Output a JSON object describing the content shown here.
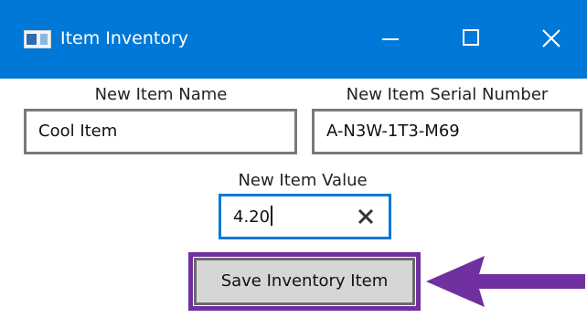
{
  "window": {
    "title": "Item Inventory",
    "icons": {
      "app": "app-window-icon",
      "minimize": "minimize-icon",
      "maximize": "maximize-icon",
      "close": "close-icon"
    }
  },
  "form": {
    "name": {
      "label": "New Item Name",
      "value": "Cool Item"
    },
    "serial": {
      "label": "New Item Serial Number",
      "value": "A-N3W-1T3-M69"
    },
    "value": {
      "label": "New Item Value",
      "value": "4.20",
      "clear_icon": "clear-x-icon"
    },
    "save_button_label": "Save Inventory Item"
  },
  "annotation": {
    "highlight_color": "#7030a0",
    "arrow_icon": "left-arrow-icon"
  },
  "colors": {
    "accent": "#0078d7",
    "titlebar_text": "#ffffff",
    "field_border": "#7a7a7a",
    "focus_border": "#0078d7",
    "button_bg": "#d6d6d6"
  }
}
